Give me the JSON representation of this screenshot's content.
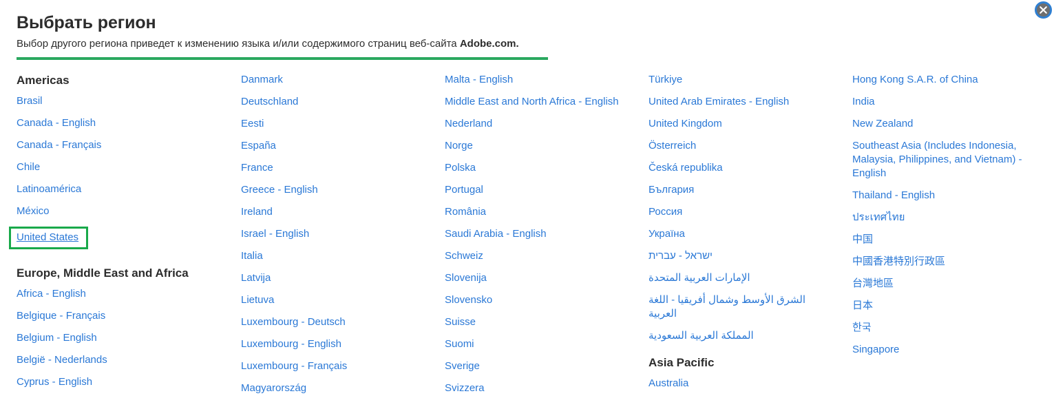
{
  "dialog": {
    "title": "Выбрать регион",
    "subtitle_prefix": "Выбор другого региона приведет к изменению языка и/или содержимого страниц веб-сайта ",
    "subtitle_brand": "Adobe.com.",
    "close_label": "×",
    "close_icon": "close-icon",
    "accent_green": "#2aa85f",
    "highlight_green": "#19a94a",
    "link_blue": "#2a78d6",
    "text_dark": "#2c2c2c"
  },
  "columns": [
    {
      "blocks": [
        {
          "heading": "Americas",
          "items": [
            {
              "label": "Brasil"
            },
            {
              "label": "Canada - English"
            },
            {
              "label": "Canada - Français"
            },
            {
              "label": "Chile"
            },
            {
              "label": "Latinoamérica"
            },
            {
              "label": "México"
            },
            {
              "label": "United States",
              "highlighted": true
            }
          ]
        },
        {
          "heading": "Europe, Middle East and Africa",
          "items": [
            {
              "label": "Africa - English"
            },
            {
              "label": "Belgique - Français"
            },
            {
              "label": "Belgium - English"
            },
            {
              "label": "België - Nederlands"
            },
            {
              "label": "Cyprus - English"
            }
          ]
        }
      ]
    },
    {
      "blocks": [
        {
          "heading": "",
          "items": [
            {
              "label": "Danmark"
            },
            {
              "label": "Deutschland"
            },
            {
              "label": "Eesti"
            },
            {
              "label": "España"
            },
            {
              "label": "France"
            },
            {
              "label": "Greece - English"
            },
            {
              "label": "Ireland"
            },
            {
              "label": "Israel - English"
            },
            {
              "label": "Italia"
            },
            {
              "label": "Latvija"
            },
            {
              "label": "Lietuva"
            },
            {
              "label": "Luxembourg - Deutsch"
            },
            {
              "label": "Luxembourg - English"
            },
            {
              "label": "Luxembourg - Français"
            },
            {
              "label": "Magyarország"
            }
          ]
        }
      ]
    },
    {
      "blocks": [
        {
          "heading": "",
          "items": [
            {
              "label": "Malta - English"
            },
            {
              "label": "Middle East and North Africa - English"
            },
            {
              "label": "Nederland"
            },
            {
              "label": "Norge"
            },
            {
              "label": "Polska"
            },
            {
              "label": "Portugal"
            },
            {
              "label": "România"
            },
            {
              "label": "Saudi Arabia - English"
            },
            {
              "label": "Schweiz"
            },
            {
              "label": "Slovenija"
            },
            {
              "label": "Slovensko"
            },
            {
              "label": "Suisse"
            },
            {
              "label": "Suomi"
            },
            {
              "label": "Sverige"
            },
            {
              "label": "Svizzera"
            }
          ]
        }
      ]
    },
    {
      "blocks": [
        {
          "heading": "",
          "items": [
            {
              "label": "Türkiye"
            },
            {
              "label": "United Arab Emirates - English"
            },
            {
              "label": "United Kingdom"
            },
            {
              "label": "Österreich"
            },
            {
              "label": "Česká republika"
            },
            {
              "label": "България"
            },
            {
              "label": "Россия"
            },
            {
              "label": "Україна"
            },
            {
              "label": "ישראל - עברית",
              "rtl": true
            },
            {
              "label": "الإمارات العربية المتحدة",
              "rtl": true
            },
            {
              "label": "الشرق الأوسط وشمال أفريقيا - اللغة العربية",
              "rtl": true
            },
            {
              "label": "المملكة العربية السعودية",
              "rtl": true
            }
          ]
        },
        {
          "heading": "Asia Pacific",
          "items": [
            {
              "label": "Australia"
            }
          ]
        }
      ]
    },
    {
      "blocks": [
        {
          "heading": "",
          "items": [
            {
              "label": "Hong Kong S.A.R. of China"
            },
            {
              "label": "India"
            },
            {
              "label": "New Zealand"
            },
            {
              "label": "Southeast Asia (Includes Indonesia, Malaysia, Philippines, and Vietnam) - English",
              "wrap": true
            },
            {
              "label": "Thailand - English"
            },
            {
              "label": "ประเทศไทย"
            },
            {
              "label": "中国"
            },
            {
              "label": "中國香港特別行政區"
            },
            {
              "label": "台灣地區"
            },
            {
              "label": "日本"
            },
            {
              "label": "한국"
            },
            {
              "label": "Singapore"
            }
          ]
        }
      ]
    }
  ]
}
